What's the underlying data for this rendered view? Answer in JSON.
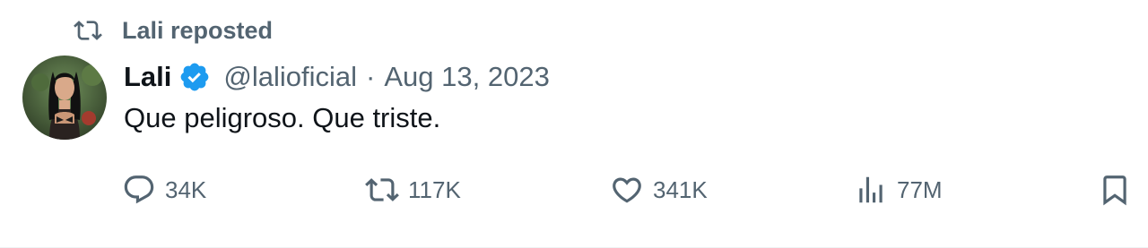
{
  "social_context": {
    "label": "Lali reposted",
    "icon": "repost-icon"
  },
  "author": {
    "name": "Lali",
    "handle": "@lalioficial",
    "separator": "·",
    "date": "Aug 13, 2023",
    "verified": true,
    "verified_color": "#1d9bf0"
  },
  "tweet": {
    "text": "Que peligroso. Que triste."
  },
  "actions": {
    "replies": "34K",
    "reposts": "117K",
    "likes": "341K",
    "views": "77M"
  },
  "colors": {
    "text_primary": "#0f1419",
    "text_secondary": "#536471",
    "accent": "#1d9bf0"
  }
}
